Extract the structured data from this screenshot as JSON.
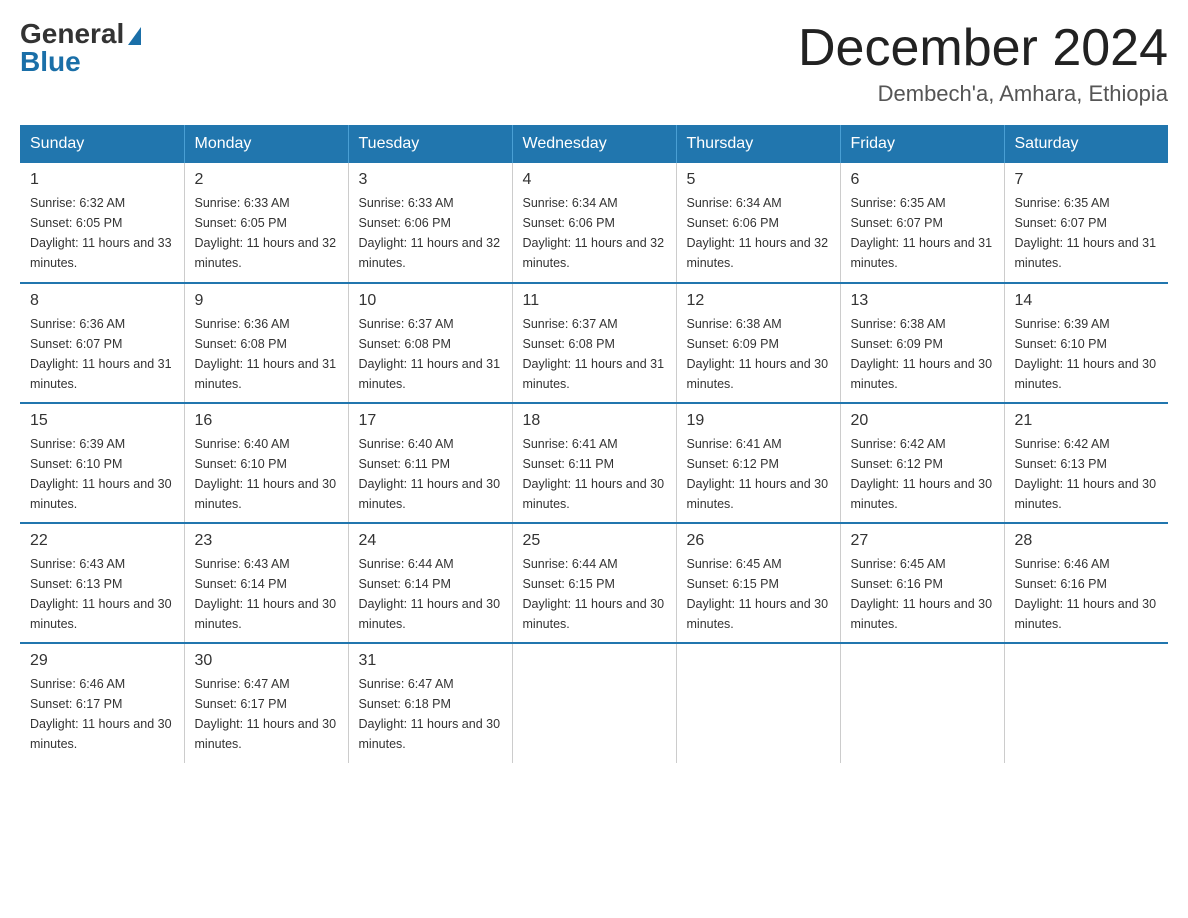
{
  "logo": {
    "general": "General",
    "blue": "Blue"
  },
  "header": {
    "month_title": "December 2024",
    "location": "Dembech'a, Amhara, Ethiopia"
  },
  "days_of_week": [
    "Sunday",
    "Monday",
    "Tuesday",
    "Wednesday",
    "Thursday",
    "Friday",
    "Saturday"
  ],
  "weeks": [
    [
      {
        "day": "1",
        "sunrise": "6:32 AM",
        "sunset": "6:05 PM",
        "daylight": "11 hours and 33 minutes."
      },
      {
        "day": "2",
        "sunrise": "6:33 AM",
        "sunset": "6:05 PM",
        "daylight": "11 hours and 32 minutes."
      },
      {
        "day": "3",
        "sunrise": "6:33 AM",
        "sunset": "6:06 PM",
        "daylight": "11 hours and 32 minutes."
      },
      {
        "day": "4",
        "sunrise": "6:34 AM",
        "sunset": "6:06 PM",
        "daylight": "11 hours and 32 minutes."
      },
      {
        "day": "5",
        "sunrise": "6:34 AM",
        "sunset": "6:06 PM",
        "daylight": "11 hours and 32 minutes."
      },
      {
        "day": "6",
        "sunrise": "6:35 AM",
        "sunset": "6:07 PM",
        "daylight": "11 hours and 31 minutes."
      },
      {
        "day": "7",
        "sunrise": "6:35 AM",
        "sunset": "6:07 PM",
        "daylight": "11 hours and 31 minutes."
      }
    ],
    [
      {
        "day": "8",
        "sunrise": "6:36 AM",
        "sunset": "6:07 PM",
        "daylight": "11 hours and 31 minutes."
      },
      {
        "day": "9",
        "sunrise": "6:36 AM",
        "sunset": "6:08 PM",
        "daylight": "11 hours and 31 minutes."
      },
      {
        "day": "10",
        "sunrise": "6:37 AM",
        "sunset": "6:08 PM",
        "daylight": "11 hours and 31 minutes."
      },
      {
        "day": "11",
        "sunrise": "6:37 AM",
        "sunset": "6:08 PM",
        "daylight": "11 hours and 31 minutes."
      },
      {
        "day": "12",
        "sunrise": "6:38 AM",
        "sunset": "6:09 PM",
        "daylight": "11 hours and 30 minutes."
      },
      {
        "day": "13",
        "sunrise": "6:38 AM",
        "sunset": "6:09 PM",
        "daylight": "11 hours and 30 minutes."
      },
      {
        "day": "14",
        "sunrise": "6:39 AM",
        "sunset": "6:10 PM",
        "daylight": "11 hours and 30 minutes."
      }
    ],
    [
      {
        "day": "15",
        "sunrise": "6:39 AM",
        "sunset": "6:10 PM",
        "daylight": "11 hours and 30 minutes."
      },
      {
        "day": "16",
        "sunrise": "6:40 AM",
        "sunset": "6:10 PM",
        "daylight": "11 hours and 30 minutes."
      },
      {
        "day": "17",
        "sunrise": "6:40 AM",
        "sunset": "6:11 PM",
        "daylight": "11 hours and 30 minutes."
      },
      {
        "day": "18",
        "sunrise": "6:41 AM",
        "sunset": "6:11 PM",
        "daylight": "11 hours and 30 minutes."
      },
      {
        "day": "19",
        "sunrise": "6:41 AM",
        "sunset": "6:12 PM",
        "daylight": "11 hours and 30 minutes."
      },
      {
        "day": "20",
        "sunrise": "6:42 AM",
        "sunset": "6:12 PM",
        "daylight": "11 hours and 30 minutes."
      },
      {
        "day": "21",
        "sunrise": "6:42 AM",
        "sunset": "6:13 PM",
        "daylight": "11 hours and 30 minutes."
      }
    ],
    [
      {
        "day": "22",
        "sunrise": "6:43 AM",
        "sunset": "6:13 PM",
        "daylight": "11 hours and 30 minutes."
      },
      {
        "day": "23",
        "sunrise": "6:43 AM",
        "sunset": "6:14 PM",
        "daylight": "11 hours and 30 minutes."
      },
      {
        "day": "24",
        "sunrise": "6:44 AM",
        "sunset": "6:14 PM",
        "daylight": "11 hours and 30 minutes."
      },
      {
        "day": "25",
        "sunrise": "6:44 AM",
        "sunset": "6:15 PM",
        "daylight": "11 hours and 30 minutes."
      },
      {
        "day": "26",
        "sunrise": "6:45 AM",
        "sunset": "6:15 PM",
        "daylight": "11 hours and 30 minutes."
      },
      {
        "day": "27",
        "sunrise": "6:45 AM",
        "sunset": "6:16 PM",
        "daylight": "11 hours and 30 minutes."
      },
      {
        "day": "28",
        "sunrise": "6:46 AM",
        "sunset": "6:16 PM",
        "daylight": "11 hours and 30 minutes."
      }
    ],
    [
      {
        "day": "29",
        "sunrise": "6:46 AM",
        "sunset": "6:17 PM",
        "daylight": "11 hours and 30 minutes."
      },
      {
        "day": "30",
        "sunrise": "6:47 AM",
        "sunset": "6:17 PM",
        "daylight": "11 hours and 30 minutes."
      },
      {
        "day": "31",
        "sunrise": "6:47 AM",
        "sunset": "6:18 PM",
        "daylight": "11 hours and 30 minutes."
      },
      null,
      null,
      null,
      null
    ]
  ]
}
